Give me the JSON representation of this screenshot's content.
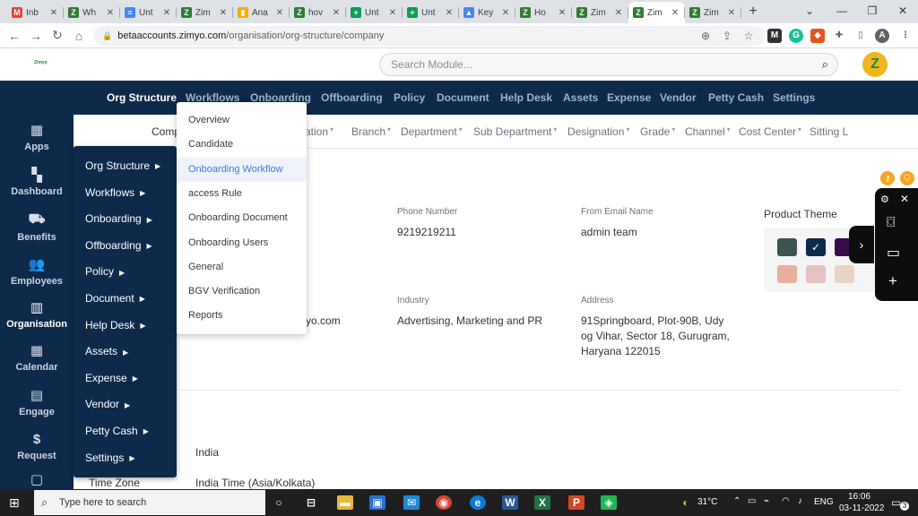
{
  "browser": {
    "tabs": [
      {
        "label": "Inb",
        "icon": "gmail-icon",
        "color": "#ea4335",
        "glyph": "M"
      },
      {
        "label": "Wh",
        "icon": "zimyo-icon",
        "color": "#2e7d32",
        "glyph": "Z"
      },
      {
        "label": "Unt",
        "icon": "docs-icon",
        "color": "#4285f4",
        "glyph": "≡"
      },
      {
        "label": "Zim",
        "icon": "zimyo-icon",
        "color": "#2e7d32",
        "glyph": "Z"
      },
      {
        "label": "Ana",
        "icon": "analytics-icon",
        "color": "#f9ab00",
        "glyph": "▮"
      },
      {
        "label": "hov",
        "icon": "zimyo-icon",
        "color": "#2e7d32",
        "glyph": "Z"
      },
      {
        "label": "Unt",
        "icon": "sheets-icon",
        "color": "#0f9d58",
        "glyph": "+"
      },
      {
        "label": "Unt",
        "icon": "sheets-icon",
        "color": "#0f9d58",
        "glyph": "+"
      },
      {
        "label": "Key",
        "icon": "ads-icon",
        "color": "#4285f4",
        "glyph": "▲"
      },
      {
        "label": "Ho",
        "icon": "zimyo-icon",
        "color": "#2e7d32",
        "glyph": "Z"
      },
      {
        "label": "Zim",
        "icon": "zimyo-icon",
        "color": "#2e7d32",
        "glyph": "Z"
      },
      {
        "label": "Zim",
        "icon": "zimyo-icon",
        "color": "#2e7d32",
        "glyph": "Z",
        "active": true
      },
      {
        "label": "Zim",
        "icon": "zimyo-icon",
        "color": "#2e7d32",
        "glyph": "Z"
      }
    ],
    "close_glyph": "✕",
    "new_tab": "+",
    "url_host": "betaaccounts.zimyo.com",
    "url_path": "/organisation/org-structure/company",
    "profile_initial": "A"
  },
  "header": {
    "logo_text": "Zimyo",
    "search_placeholder": "Search Module...",
    "avatar_glyph": "Z"
  },
  "topnav": {
    "items": [
      "Org Structure",
      "Workflows",
      "Onboarding",
      "Offboarding",
      "Policy",
      "Document",
      "Help Desk",
      "Assets",
      "Expense",
      "Vendor",
      "Petty Cash",
      "Settings"
    ]
  },
  "sidebar": {
    "items": [
      {
        "label": "Apps",
        "icon": "apps-grid-icon",
        "glyph": "▦"
      },
      {
        "label": "Dashboard",
        "icon": "dashboard-icon",
        "glyph": "▚"
      },
      {
        "label": "Benefits",
        "icon": "benefits-icon",
        "glyph": "⛟"
      },
      {
        "label": "Employees",
        "icon": "employees-icon",
        "glyph": "👥"
      },
      {
        "label": "Organisation",
        "icon": "organisation-icon",
        "glyph": "▥"
      },
      {
        "label": "Calendar",
        "icon": "calendar-icon",
        "glyph": "▦"
      },
      {
        "label": "Engage",
        "icon": "engage-icon",
        "glyph": "▤"
      },
      {
        "label": "Request",
        "icon": "request-icon",
        "glyph": "$"
      }
    ]
  },
  "subnav": {
    "items": [
      "Comp",
      "cation",
      "Branch",
      "Department",
      "Sub Department",
      "Designation",
      "Grade",
      "Channel",
      "Cost Center",
      "Sitting L"
    ]
  },
  "company": {
    "phone_label": "Phone Number",
    "phone_value": "9219219211",
    "from_email_label": "From Email Name",
    "from_email_value": "admin team",
    "industry_label": "Industry",
    "industry_value": "Advertising, Marketing and PR",
    "address_label": "Address",
    "address_line1": "91Springboard, Plot-90B, Udy",
    "address_line2": "og Vihar, Sector 18, Gurugram,",
    "address_line3": "Haryana 122015",
    "email_partial": "yo.com",
    "country_value": "India",
    "timezone_label": "Time Zone",
    "timezone_value": "India Time (Asia/Kolkata)"
  },
  "theme": {
    "title": "Product Theme",
    "check": "✓",
    "swatches": [
      "#3d5550",
      "#0d2a4a",
      "#3a0a4a",
      "#e8b09a",
      "#e8c0c4",
      "#e8d4c4"
    ]
  },
  "main_menu": {
    "items": [
      "Org Structure",
      "Workflows",
      "Onboarding",
      "Offboarding",
      "Policy",
      "Document",
      "Help Desk",
      "Assets",
      "Expense",
      "Vendor",
      "Petty Cash",
      "Settings"
    ]
  },
  "onboarding_submenu": {
    "items": [
      "Overview",
      "Candidate",
      "Onboarding Workflow",
      "access Rule",
      "Onboarding Document",
      "Onboarding Users",
      "General",
      "BGV Verification",
      "Reports"
    ],
    "active": "Onboarding Workflow"
  },
  "taskbar": {
    "search_placeholder": "Type here to search",
    "temperature": "31°C",
    "language": "ENG",
    "time": "16:06",
    "date": "03-11-2022",
    "notification_count": "3"
  }
}
